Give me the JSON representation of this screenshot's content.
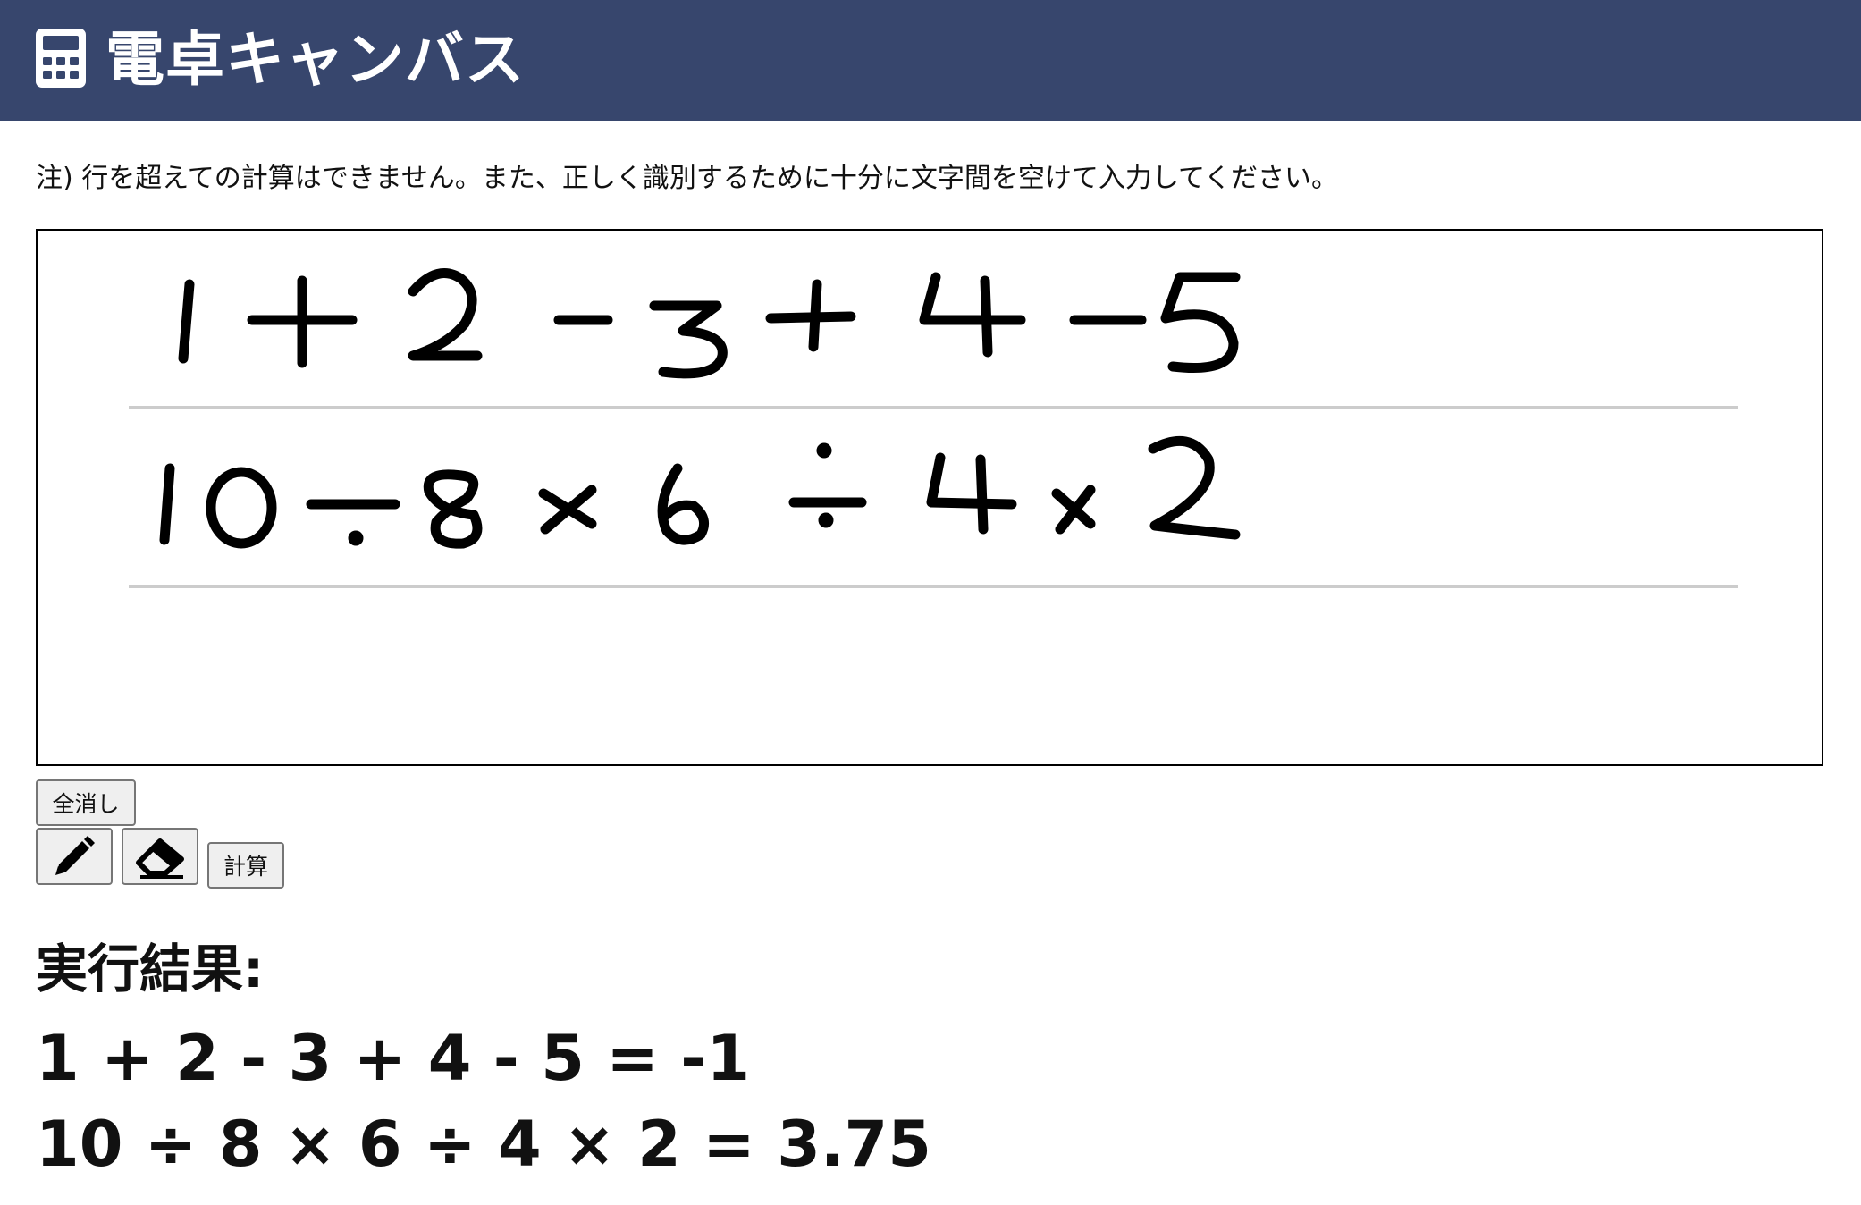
{
  "header": {
    "title": "電卓キャンバス",
    "icon": "calculator-icon",
    "background_color": "#37466d"
  },
  "note": "注) 行を超えての計算はできません。また、正しく識別するために十分に文字間を空けて入力してください。",
  "canvas": {
    "line_1_handwritten": "1 + 2 - 3 + 4 - 5",
    "line_2_handwritten": "10 ÷ 8 × 6 ÷ 4 × 2"
  },
  "toolbar": {
    "clear_label": "全消し",
    "pen_icon": "pencil-icon",
    "eraser_icon": "eraser-icon",
    "calc_label": "計算"
  },
  "results": {
    "heading": "実行結果:",
    "lines": [
      "1 + 2 - 3 + 4 - 5 = -1",
      "10 ÷ 8 × 6 ÷ 4 × 2 = 3.75"
    ]
  }
}
